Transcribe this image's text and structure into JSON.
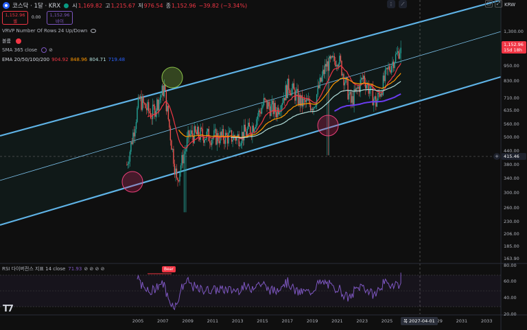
{
  "header": {
    "title": "코스닥 · 1달 · KRX",
    "open_label": "시",
    "open": "1,169.82",
    "high_label": "고",
    "high": "1,215.67",
    "low_label": "저",
    "low": "976.54",
    "close_label": "종",
    "close": "1,152.96",
    "change": "−39.82 (−3.34%)"
  },
  "order": {
    "sell_price": "1,152.96",
    "sell_label": "셀",
    "spread": "0.00",
    "buy_price": "1,152.96",
    "buy_label": "바이"
  },
  "indicators": {
    "vrvp": "VRVP Number Of Rows 24 Up/Down",
    "volume": "볼륨",
    "sma": "SMA 365 close",
    "ema": "EMA 20/50/100/200",
    "ema_values": [
      "904.92",
      "848.96",
      "804.71",
      "719.48"
    ],
    "ema_colors": [
      "#f23645",
      "#ff9800",
      "#b2dfdb",
      "#2962ff"
    ]
  },
  "price_axis": {
    "currency": "KRW",
    "ticks": [
      "1,300.00",
      "1,150.00",
      "950.00",
      "830.00",
      "710.00",
      "635.00",
      "560.00",
      "500.00",
      "440.00",
      "380.00",
      "340.00",
      "300.00",
      "260.00",
      "230.00",
      "206.00",
      "185.00",
      "163.90"
    ],
    "current_price": "1,152.96",
    "countdown": "15d 18h",
    "crosshair_price": "415.46"
  },
  "time_axis": {
    "labels": [
      "2005",
      "2007",
      "2009",
      "2011",
      "2013",
      "2015",
      "2017",
      "2019",
      "2021",
      "2023",
      "2025",
      "2029",
      "2031",
      "2033"
    ],
    "crosshair_date": "목 2027-04-01"
  },
  "rsi": {
    "label": "RSI 다이버전스 지표 14 close",
    "value": "71.93",
    "ticks": [
      "80.00",
      "60.00",
      "40.00",
      "20.00"
    ],
    "bear_label": "Bear",
    "color": "#7e57c2"
  },
  "chart_data": {
    "type": "candlestick",
    "interval": "1M",
    "symbol": "코스닥",
    "log_scale": true,
    "current_price": 1152.96,
    "ema_values": {
      "20": 904.92,
      "50": 848.96,
      "100": 804.71,
      "200": 719.48
    },
    "rsi_value": 71.93,
    "closes_yearly": [
      {
        "year": 2004,
        "price": 380
      },
      {
        "year": 2005,
        "price": 700
      },
      {
        "year": 2006,
        "price": 610
      },
      {
        "year": 2007,
        "price": 780
      },
      {
        "year": 2008,
        "price": 330
      },
      {
        "year": 2009,
        "price": 510
      },
      {
        "year": 2010,
        "price": 510
      },
      {
        "year": 2011,
        "price": 500
      },
      {
        "year": 2012,
        "price": 500
      },
      {
        "year": 2013,
        "price": 500
      },
      {
        "year": 2014,
        "price": 540
      },
      {
        "year": 2015,
        "price": 680
      },
      {
        "year": 2016,
        "price": 630
      },
      {
        "year": 2017,
        "price": 800
      },
      {
        "year": 2018,
        "price": 680
      },
      {
        "year": 2019,
        "price": 670
      },
      {
        "year": 2020,
        "price": 960
      },
      {
        "year": 2021,
        "price": 1030
      },
      {
        "year": 2022,
        "price": 680
      },
      {
        "year": 2023,
        "price": 860
      },
      {
        "year": 2024,
        "price": 680
      },
      {
        "year": 2025,
        "price": 920
      },
      {
        "year": 2026,
        "price": 1152.96
      }
    ]
  }
}
